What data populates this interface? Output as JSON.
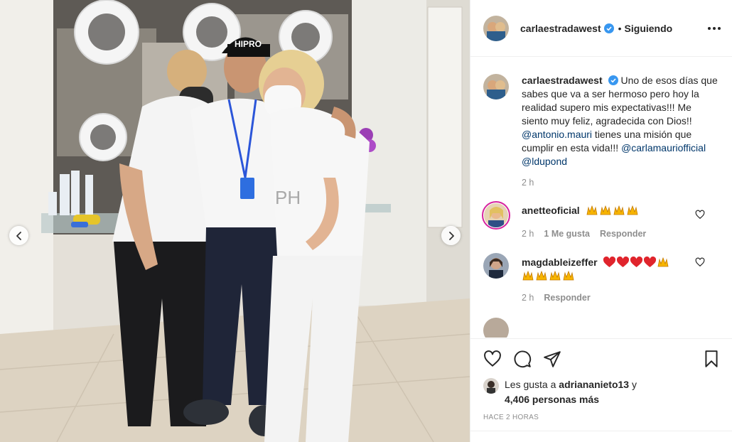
{
  "post": {
    "image_alt": "Foto de tres personas abrazadas en un salón",
    "prev_icon": "chevron-left-icon",
    "next_icon": "chevron-right-icon",
    "cap_text": "HIPRO",
    "shirt_text": "PH"
  },
  "header": {
    "username": "carlaestradawest",
    "separator": "•",
    "follow_status": "Siguiendo",
    "more_icon": "ellipsis-icon"
  },
  "caption": {
    "username": "carlaestradawest",
    "text_before": "Uno de esos días que sabes que va a ser hermoso pero hoy la realidad supero mis expectativas!!! Me siento muy feliz, agradecida con Dios!! ",
    "mention1": "@antonio.mauri",
    "text_middle": " tienes una misión que cumplir en esta vida!!! ",
    "mention2": "@carlamauriofficial",
    "mention3": "@ldupond",
    "time": "2 h"
  },
  "comments": [
    {
      "username": "anetteoficial",
      "emojis": "🙌🙌🙌🙌",
      "time": "2 h",
      "likes": "1 Me gusta",
      "reply": "Responder"
    },
    {
      "username": "magdableizeffer",
      "emojis": "❤️❤️❤️❤️🙌🙌🙌🙌🙌",
      "time": "2 h",
      "reply": "Responder"
    }
  ],
  "actions": {
    "like_icon": "heart-icon",
    "comment_icon": "comment-icon",
    "share_icon": "paper-plane-icon",
    "save_icon": "bookmark-icon"
  },
  "likes": {
    "prefix": "Les gusta a ",
    "user": "adriananieto13",
    "connector": " y",
    "others": "4,406 personas más"
  },
  "timestamp": "Hace 2 horas",
  "colors": {
    "verified": "#3897f0",
    "mention": "#00376b",
    "meta": "#8e8e8e"
  }
}
